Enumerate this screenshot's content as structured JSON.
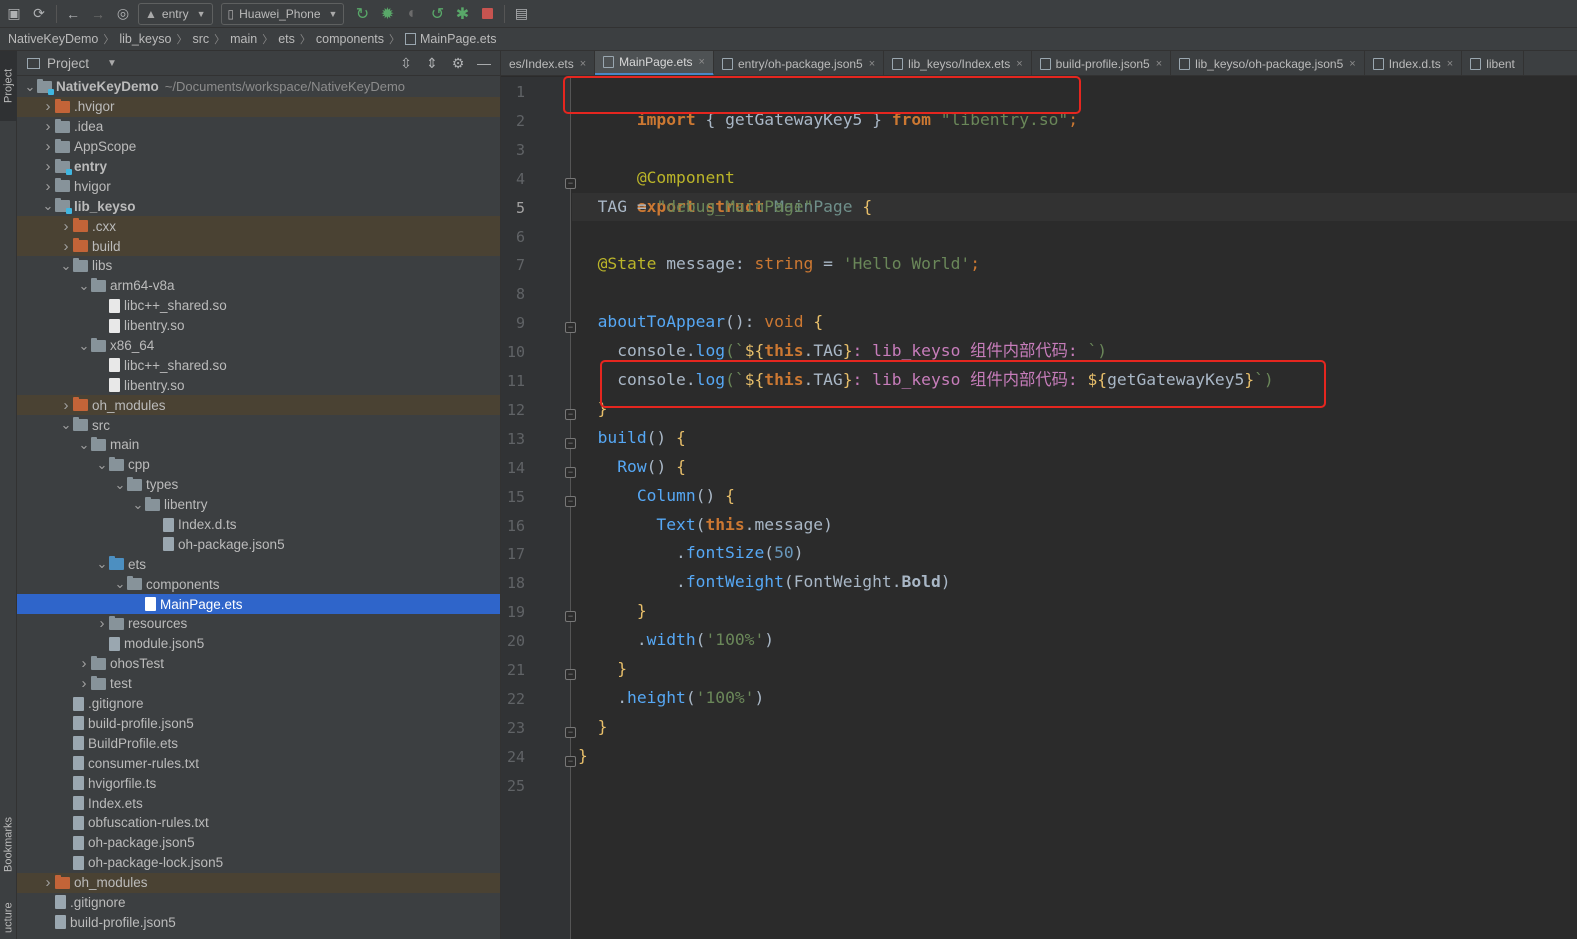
{
  "toolbar": {
    "module_combo": "entry",
    "device_combo": "Huawei_Phone"
  },
  "breadcrumb": [
    "NativeKeyDemo",
    "lib_keyso",
    "src",
    "main",
    "ets",
    "components",
    "MainPage.ets"
  ],
  "project": {
    "title": "Project",
    "tree": [
      {
        "label": "NativeKeyDemo",
        "path": "~/Documents/workspace/NativeKeyDemo",
        "depth": 0,
        "arrow": "open",
        "icon": "module",
        "bold": true
      },
      {
        "label": ".hvigor",
        "depth": 1,
        "arrow": "closed",
        "icon": "folder-orange",
        "excluded": true
      },
      {
        "label": ".idea",
        "depth": 1,
        "arrow": "closed",
        "icon": "folder"
      },
      {
        "label": "AppScope",
        "depth": 1,
        "arrow": "closed",
        "icon": "folder"
      },
      {
        "label": "entry",
        "depth": 1,
        "arrow": "closed",
        "icon": "module",
        "bold": true
      },
      {
        "label": "hvigor",
        "depth": 1,
        "arrow": "closed",
        "icon": "folder"
      },
      {
        "label": "lib_keyso",
        "depth": 1,
        "arrow": "open",
        "icon": "module",
        "bold": true
      },
      {
        "label": ".cxx",
        "depth": 2,
        "arrow": "closed",
        "icon": "folder-orange",
        "excluded": true
      },
      {
        "label": "build",
        "depth": 2,
        "arrow": "closed",
        "icon": "folder-orange",
        "excluded": true
      },
      {
        "label": "libs",
        "depth": 2,
        "arrow": "open",
        "icon": "folder"
      },
      {
        "label": "arm64-v8a",
        "depth": 3,
        "arrow": "open",
        "icon": "folder"
      },
      {
        "label": "libc++_shared.so",
        "depth": 4,
        "arrow": "none",
        "icon": "file"
      },
      {
        "label": "libentry.so",
        "depth": 4,
        "arrow": "none",
        "icon": "file"
      },
      {
        "label": "x86_64",
        "depth": 3,
        "arrow": "open",
        "icon": "folder"
      },
      {
        "label": "libc++_shared.so",
        "depth": 4,
        "arrow": "none",
        "icon": "file"
      },
      {
        "label": "libentry.so",
        "depth": 4,
        "arrow": "none",
        "icon": "file"
      },
      {
        "label": "oh_modules",
        "depth": 2,
        "arrow": "closed",
        "icon": "folder-orange",
        "excluded": true
      },
      {
        "label": "src",
        "depth": 2,
        "arrow": "open",
        "icon": "folder"
      },
      {
        "label": "main",
        "depth": 3,
        "arrow": "open",
        "icon": "folder"
      },
      {
        "label": "cpp",
        "depth": 4,
        "arrow": "open",
        "icon": "folder"
      },
      {
        "label": "types",
        "depth": 5,
        "arrow": "open",
        "icon": "folder"
      },
      {
        "label": "libentry",
        "depth": 6,
        "arrow": "open",
        "icon": "folder"
      },
      {
        "label": "Index.d.ts",
        "depth": 7,
        "arrow": "none",
        "icon": "file-cfg"
      },
      {
        "label": "oh-package.json5",
        "depth": 7,
        "arrow": "none",
        "icon": "file-cfg"
      },
      {
        "label": "ets",
        "depth": 4,
        "arrow": "open",
        "icon": "folder-blue"
      },
      {
        "label": "components",
        "depth": 5,
        "arrow": "open",
        "icon": "folder"
      },
      {
        "label": "MainPage.ets",
        "depth": 6,
        "arrow": "none",
        "icon": "file-ets",
        "selected": true
      },
      {
        "label": "resources",
        "depth": 4,
        "arrow": "closed",
        "icon": "folder"
      },
      {
        "label": "module.json5",
        "depth": 4,
        "arrow": "none",
        "icon": "file-cfg"
      },
      {
        "label": "ohosTest",
        "depth": 3,
        "arrow": "closed",
        "icon": "folder"
      },
      {
        "label": "test",
        "depth": 3,
        "arrow": "closed",
        "icon": "folder"
      },
      {
        "label": ".gitignore",
        "depth": 2,
        "arrow": "none",
        "icon": "file-cfg"
      },
      {
        "label": "build-profile.json5",
        "depth": 2,
        "arrow": "none",
        "icon": "file-cfg"
      },
      {
        "label": "BuildProfile.ets",
        "depth": 2,
        "arrow": "none",
        "icon": "file-cfg"
      },
      {
        "label": "consumer-rules.txt",
        "depth": 2,
        "arrow": "none",
        "icon": "file-cfg"
      },
      {
        "label": "hvigorfile.ts",
        "depth": 2,
        "arrow": "none",
        "icon": "file-cfg"
      },
      {
        "label": "Index.ets",
        "depth": 2,
        "arrow": "none",
        "icon": "file-cfg"
      },
      {
        "label": "obfuscation-rules.txt",
        "depth": 2,
        "arrow": "none",
        "icon": "file-cfg"
      },
      {
        "label": "oh-package.json5",
        "depth": 2,
        "arrow": "none",
        "icon": "file-cfg"
      },
      {
        "label": "oh-package-lock.json5",
        "depth": 2,
        "arrow": "none",
        "icon": "file-cfg"
      },
      {
        "label": "oh_modules",
        "depth": 1,
        "arrow": "closed",
        "icon": "folder-orange",
        "excluded": true
      },
      {
        "label": ".gitignore",
        "depth": 1,
        "arrow": "none",
        "icon": "file-cfg"
      },
      {
        "label": "build-profile.json5",
        "depth": 1,
        "arrow": "none",
        "icon": "file-cfg"
      }
    ]
  },
  "side_strip": {
    "project": "Project",
    "bookmarks": "Bookmarks",
    "structure": "ucture"
  },
  "tabs": [
    {
      "label": "es/Index.ets",
      "active": false
    },
    {
      "label": "MainPage.ets",
      "active": true
    },
    {
      "label": "entry/oh-package.json5",
      "active": false
    },
    {
      "label": "lib_keyso/Index.ets",
      "active": false
    },
    {
      "label": "build-profile.json5",
      "active": false
    },
    {
      "label": "lib_keyso/oh-package.json5",
      "active": false
    },
    {
      "label": "Index.d.ts",
      "active": false
    },
    {
      "label": "libent",
      "active": false
    }
  ],
  "editor": {
    "current_line": 5,
    "line_numbers": [
      "1",
      "2",
      "3",
      "4",
      "5",
      "6",
      "7",
      "8",
      "9",
      "10",
      "11",
      "12",
      "13",
      "14",
      "15",
      "16",
      "17",
      "18",
      "19",
      "20",
      "21",
      "22",
      "23",
      "24",
      "25"
    ],
    "code": {
      "l1": {
        "import": "import",
        "ob": "{",
        "name": "getGatewayKey5",
        "cb": "}",
        "from": "from",
        "mod": "\"libentry.so\"",
        "semi": ";"
      },
      "l3": {
        "dec": "@Component"
      },
      "l4": {
        "export": "export",
        "struct": "struct",
        "name": "MainPage",
        "brace": "{"
      },
      "l5": {
        "prop": "TAG",
        "eq": "=",
        "val": "\"debug_MainPage\""
      },
      "l7": {
        "dec": "@State",
        "prop": "message",
        "colon": ":",
        "type": "string",
        "eq": "=",
        "val": "'Hello World'",
        "semi": ";"
      },
      "l9": {
        "fn": "aboutToAppear",
        "paren": "()",
        "colon": ":",
        "type": "void",
        "brace": "{"
      },
      "l10": {
        "obj": "console",
        "dot": ".",
        "fn": "log",
        "op": "(`",
        "interp": "${",
        "this": "this",
        "tag": ".TAG",
        "ic": "}",
        "text": ": lib_keyso 组件内部代码: ",
        "end": "`)"
      },
      "l11": {
        "obj": "console",
        "dot": ".",
        "fn": "log",
        "op": "(`",
        "interp": "${",
        "this": "this",
        "tag": ".TAG",
        "ic": "}",
        "text": ": lib_keyso 组件内部代码: ",
        "interp2": "${",
        "call": "getGatewayKey5",
        "ic2": "}",
        "end": "`)"
      },
      "l12": {
        "brace": "}"
      },
      "l13": {
        "fn": "build",
        "paren": "()",
        "brace": "{"
      },
      "l14": {
        "fn": "Row",
        "paren": "()",
        "brace": "{"
      },
      "l15": {
        "fn": "Column",
        "paren": "()",
        "brace": "{"
      },
      "l16": {
        "fn": "Text",
        "op": "(",
        "this": "this",
        "rest": ".message",
        "cp": ")"
      },
      "l17": {
        "dot": ".",
        "fn": "fontSize",
        "op": "(",
        "num": "50",
        "cp": ")"
      },
      "l18": {
        "dot": ".",
        "fn": "fontWeight",
        "op": "(",
        "cls": "FontWeight",
        "dot2": ".",
        "val": "Bold",
        "cp": ")"
      },
      "l19": {
        "brace": "}"
      },
      "l20": {
        "dot": ".",
        "fn": "width",
        "op": "(",
        "val": "'100%'",
        "cp": ")"
      },
      "l21": {
        "brace": "}"
      },
      "l22": {
        "dot": ".",
        "fn": "height",
        "op": "(",
        "val": "'100%'",
        "cp": ")"
      },
      "l23": {
        "brace": "}"
      },
      "l24": {
        "brace": "}"
      }
    }
  },
  "colors": {
    "accent_selection": "#2f65ca",
    "highlight_box": "#e5261f",
    "editor_bg": "#2b2b2b",
    "panel_bg": "#3c3f41"
  }
}
